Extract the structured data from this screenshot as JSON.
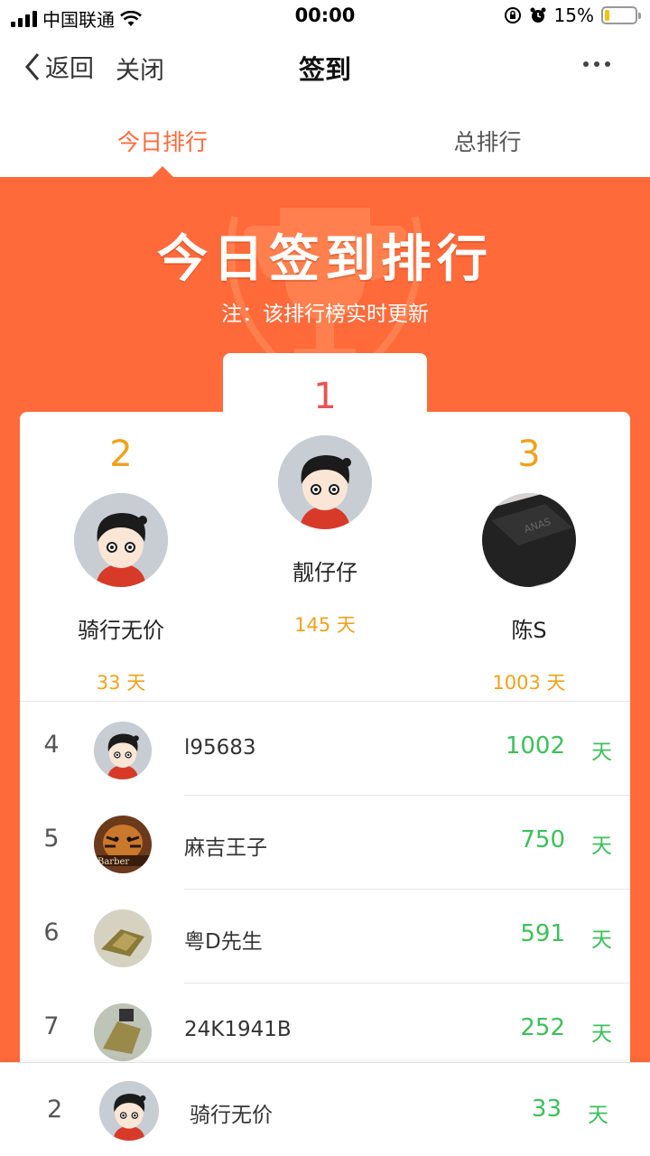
{
  "status_bar": {
    "carrier": "中国联通",
    "time": "00:00",
    "battery": "15%",
    "battery_level": 0.15
  },
  "nav": {
    "back_label": "返回",
    "close_label": "关闭",
    "title": "签到"
  },
  "tabs": [
    {
      "label": "今日排行",
      "active": true
    },
    {
      "label": "总排行",
      "active": false
    }
  ],
  "banner": {
    "title": "今日签到排行",
    "note": "注：该排行榜实时更新"
  },
  "podium": {
    "first": {
      "rank": "1",
      "name": "靓仔仔",
      "days": "145 天",
      "avatar": "cartoon-boy-avatar"
    },
    "second": {
      "rank": "2",
      "name": "骑行无价",
      "days": "33 天",
      "avatar": "cartoon-boy-avatar"
    },
    "third": {
      "rank": "3",
      "name": "陈S",
      "days": "1003 天",
      "avatar": "dark-device-photo-avatar"
    }
  },
  "list": [
    {
      "rank": "4",
      "name": "l95683",
      "days": "1002",
      "unit": "天",
      "avatar": "cartoon-boy-avatar"
    },
    {
      "rank": "5",
      "name": "麻吉王子",
      "days": "750",
      "unit": "天",
      "avatar": "tiger-photo-avatar"
    },
    {
      "rank": "6",
      "name": "粤D先生",
      "days": "591",
      "unit": "天",
      "avatar": "gold-object-photo-avatar"
    },
    {
      "rank": "7",
      "name": "24K1941B",
      "days": "252",
      "unit": "天",
      "avatar": "gold-object-photo-avatar"
    }
  ],
  "self": {
    "rank": "2",
    "name": "骑行无价",
    "days": "33",
    "unit": "天",
    "avatar": "cartoon-boy-avatar"
  },
  "colors": {
    "accent": "#ff6a3a",
    "gold": "#f0a21b",
    "first_place": "#e65454",
    "days_green": "#3cc05a"
  }
}
